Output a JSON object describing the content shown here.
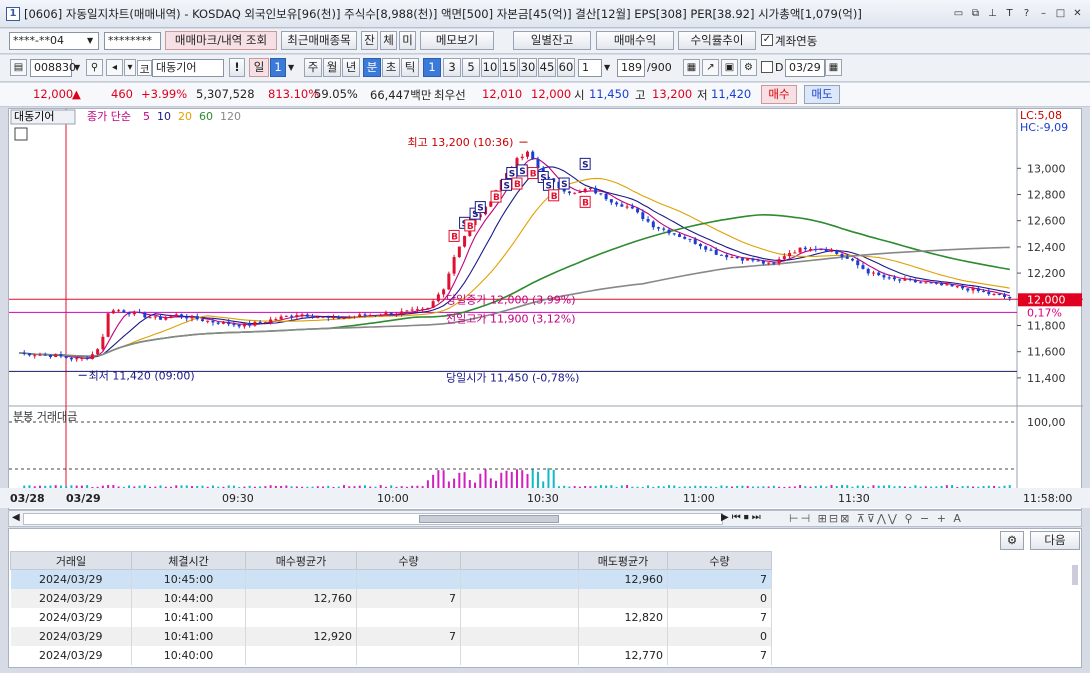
{
  "window": {
    "title": "[0606] 자동일지차트(매매내역) - KOSDAQ 외국인보유[96(천)] 주식수[8,988(천)] 액면[500] 자본금[45(억)] 결산[12월] EPS[308] PER[38.92] 시가총액[1,079(억)]",
    "app_icon": "1"
  },
  "account": {
    "number": "****-**04",
    "password": "********"
  },
  "toolbar1": {
    "trade_mark": "매매마크/내역 조회",
    "recent": "최근매매종목",
    "jan": "잔",
    "che": "체",
    "mi": "미",
    "memo": "메모보기",
    "daily_balance": "일별잔고",
    "trade_profit": "매매수익",
    "return_trend": "수익률추이",
    "link_account": "계좌연동"
  },
  "toolbar2": {
    "code": "008830",
    "market": "코",
    "name": "대동기어",
    "excl": "!",
    "period_il": "일",
    "period_num": "1",
    "ju": "주",
    "wol": "월",
    "nyeon": "년",
    "bun": "분",
    "cho": "초",
    "tik": "틱",
    "intervals": [
      "1",
      "3",
      "5",
      "10",
      "15",
      "30",
      "45",
      "60"
    ],
    "count_sel": "1",
    "count": "189",
    "count_total": "/900",
    "check_d": "D",
    "date": "03/29"
  },
  "quote": {
    "price": "12,000",
    "arrow": "▲",
    "change": "460",
    "pct": "+3.99%",
    "volume": "5,307,528",
    "vol_ratio": "813.10%",
    "ratio2": "59.05%",
    "amount": "66,447백만",
    "best_label": "최우선",
    "ask": "12,010",
    "bid": "12,000",
    "open_label": "시",
    "open": "11,450",
    "high_label": "고",
    "high": "13,200",
    "low_label": "저",
    "low": "11,420",
    "buy": "매수",
    "sell": "매도"
  },
  "chart_data": {
    "type": "candlestick",
    "stock": "대동기어",
    "legend": [
      "종가 단순",
      "5",
      "10",
      "20",
      "60",
      "120"
    ],
    "yticks": [
      13000,
      12800,
      12600,
      12400,
      12200,
      12000,
      11800,
      11600,
      11400
    ],
    "ylim": [
      11300,
      13300
    ],
    "xticks": [
      "03/28",
      "03/29",
      "09:30",
      "10:00",
      "10:30",
      "11:00",
      "11:30",
      "11:58:00"
    ],
    "annotations": {
      "high": "최고 13,200 (10:36)",
      "low": "최저 11,420 (09:00)",
      "today_close": "당일종가 12,000 (3,99%)",
      "prev_line": "전일고가 11,900 (3,12%)",
      "open_line": "당일시가 11,450 (-0,78%)"
    },
    "levels": {
      "close": 12000,
      "prev": 11900,
      "open": 11450
    },
    "right_labels": {
      "lc": "LC:5,08",
      "hc": "HC:-9,09",
      "price": "12,000",
      "pct": "0,17%"
    },
    "volume_panel": {
      "title": "분봉 거래대금",
      "ytick": "100,00"
    },
    "marks": [
      {
        "t": "B",
        "x": 125,
        "p": 12480
      },
      {
        "t": "S",
        "x": 127,
        "p": 12580
      },
      {
        "t": "B",
        "x": 129,
        "p": 12560
      },
      {
        "t": "S",
        "x": 130,
        "p": 12650
      },
      {
        "t": "S",
        "x": 132,
        "p": 12700
      },
      {
        "t": "B",
        "x": 137,
        "p": 12780
      },
      {
        "t": "S",
        "x": 139,
        "p": 12870
      },
      {
        "t": "S",
        "x": 141,
        "p": 12960
      },
      {
        "t": "B",
        "x": 142,
        "p": 12880
      },
      {
        "t": "S",
        "x": 145,
        "p": 12980
      },
      {
        "t": "B",
        "x": 148,
        "p": 12960
      },
      {
        "t": "S",
        "x": 150,
        "p": 12930
      },
      {
        "t": "S",
        "x": 152,
        "p": 12870
      },
      {
        "t": "B",
        "x": 154,
        "p": 12790
      },
      {
        "t": "S",
        "x": 157,
        "p": 12880
      },
      {
        "t": "B",
        "x": 162,
        "p": 12740
      },
      {
        "t": "S",
        "x": 163,
        "p": 13030
      }
    ]
  },
  "axis": {
    "labels": [
      "03/28",
      "03/29",
      "09:30",
      "10:00",
      "10:30",
      "11:00",
      "11:30",
      "11:58:00"
    ]
  },
  "table": {
    "next": "다음",
    "headers": [
      "거래일",
      "체결시간",
      "매수평균가",
      "수량",
      "",
      "매도평균가",
      "수량"
    ],
    "rows": [
      [
        "2024/03/29",
        "10:45:00",
        "",
        "",
        "",
        "12,960",
        "7"
      ],
      [
        "2024/03/29",
        "10:44:00",
        "12,760",
        "7",
        "",
        "",
        "0"
      ],
      [
        "2024/03/29",
        "10:41:00",
        "",
        "",
        "",
        "12,820",
        "7"
      ],
      [
        "2024/03/29",
        "10:41:00",
        "12,920",
        "7",
        "",
        "",
        "0"
      ],
      [
        "2024/03/29",
        "10:40:00",
        "",
        "",
        "",
        "12,770",
        "7"
      ]
    ]
  }
}
